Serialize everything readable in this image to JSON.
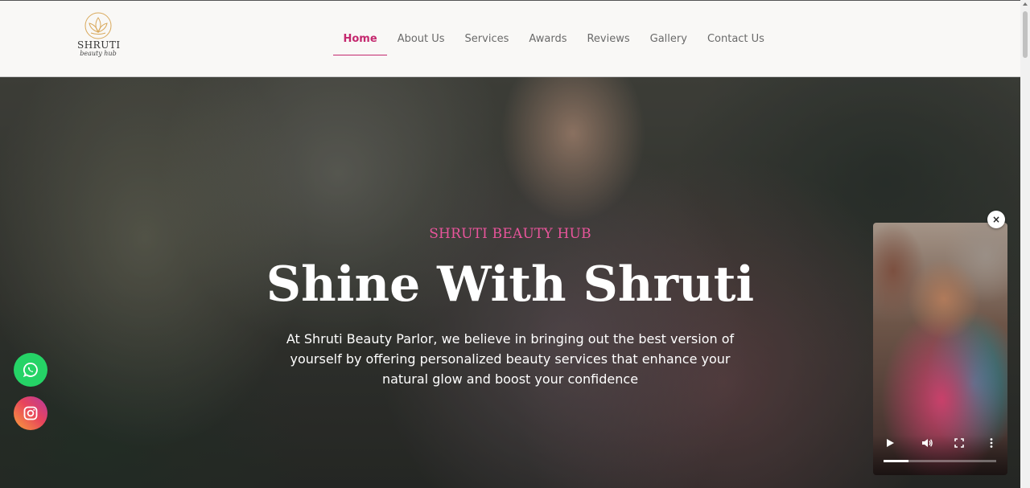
{
  "header": {
    "logo": {
      "brand": "SHRUTI",
      "sub": "beauty hub",
      "icon": "lotus-icon"
    },
    "nav": [
      {
        "label": "Home",
        "active": true
      },
      {
        "label": "About Us"
      },
      {
        "label": "Services"
      },
      {
        "label": "Awards"
      },
      {
        "label": "Reviews"
      },
      {
        "label": "Gallery"
      },
      {
        "label": "Contact Us"
      }
    ]
  },
  "hero": {
    "kicker": "SHRUTI BEAUTY HUB",
    "title": "Shine With Shruti",
    "text": "At Shruti Beauty Parlor, we believe in bringing out the best version of yourself by offering personalized beauty services that enhance your natural glow and boost your confidence"
  },
  "social": [
    {
      "name": "whatsapp",
      "icon": "whatsapp-icon",
      "color": "#25d366"
    },
    {
      "name": "instagram",
      "icon": "instagram-icon"
    }
  ],
  "video": {
    "close_label": "×",
    "controls": [
      "play-icon",
      "volume-icon",
      "fullscreen-icon",
      "more-icon"
    ],
    "progress": 0.22
  },
  "colors": {
    "accent": "#c4286e",
    "kicker": "#e8559b"
  }
}
